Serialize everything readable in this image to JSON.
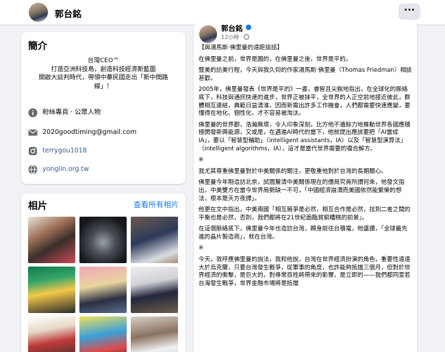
{
  "header": {
    "name": "郭台銘",
    "more_icon": "more-horizontal-icon",
    "more_label": "···"
  },
  "intro": {
    "title": "簡介",
    "bio": [
      "台灣CEO™",
      "打造亞洲科技島，創造科技經濟新藍圖",
      "開啟大談判時代，帶領中華民國走出「新中間路",
      "線」！"
    ],
    "rows": [
      {
        "icon": "info-icon",
        "text": "粉絲專頁 · 公眾人物",
        "link": false
      },
      {
        "icon": "email-icon",
        "text": "2020goodtiming@gmail.com",
        "link": false
      },
      {
        "icon": "instagram-icon",
        "text": "terrygou1018",
        "link": true
      },
      {
        "icon": "globe-icon",
        "text": "yonglin.org.tw",
        "link": true
      }
    ]
  },
  "photos": {
    "title": "相片",
    "see_all": "查看所有相片"
  },
  "post": {
    "author": "郭台銘",
    "time": "12小時 ·",
    "paragraphs": [
      "【與湯馬斯·佛里曼的遠距談話】",
      "在佛里曼之前，世界是圓的，在佛里曼之後，世界是平的。",
      "暨美的訪美行程，今天與我久仰的作家湯馬斯·佛里曼（Thomas Friedman）相談甚歡。",
      "2005年，佛里曼發表《世界是平的》一書，睿智且尖銳地指出，在全球化的脈絡底下，科技與通訊快速的進步，世界正被抹平，全世界的人正空前地接近彼此，群體相互連結，典範日益清淮，因而新需出許多工作機會，人們都需要快速應變，要懂得在地化、個性化，才不容易被淘汰。",
      "佛里曼的世界觀，浩瀚無垠，令人印象深刻，比方他不遺餘力地推動世界各國應積極開發新興能源，又或是，在邁進AI時代的當下，他就提出應該要把「AI當成IA」，要以「智慧型輔助」（intelligent assistants，IA）以及「智慧型演算法」（intelligent algorithms，IA），這才是當代世界需要的複合解方。",
      "※",
      "我尤其尊重佛里曼對於中美關係的關注，更敬重他對於台灣的長期關心。",
      "佛里曼今年剛造訪北京，試圖釐清中美關係現在的僵局究竟所謂何來，他發文指出，中美雙方在當今世界局勢缺一不可，「中國經濟崩潰而美國依然能繁榮的想法，根本是天方夜譚」。",
      "他更在文中指出，中美兩國「相互競爭是必然，相互合作是必然，找到二者之間的平衡也是必然，否則，我們都將在21世紀面臨貧窮糟糕的前景」。",
      "在這個脈絡底下，佛里曼今年也造訪台灣，親身前往台積電，他盛讚，「全球最先進的晶片製造商」，就在台灣。",
      "※",
      "今天，我呼應佛里曼的說法，我和他說，台灣在世界經濟扮演的角色，重要性遠遠大於烏克蘭，只要台灣發生戰爭，從軍事的角度，也許能夠抵擋三個月，但對於世界經濟的衝擊，是巨大的，對尋常百姓將帶來的影響，是立即的——我們都同意若台海發生戰爭，世界金融市場將是抵擋"
    ]
  }
}
